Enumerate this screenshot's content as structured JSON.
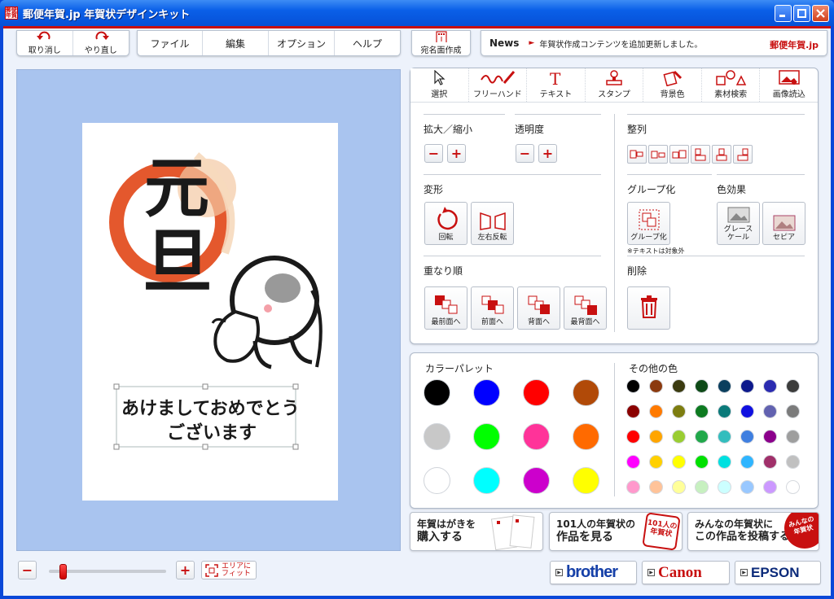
{
  "window": {
    "title": "郵便年賀.jp 年賀状デザインキット",
    "icon_text": "郵便年賀"
  },
  "toolbar": {
    "undo": "取り消し",
    "redo": "やり直し",
    "menu": [
      "ファイル",
      "編集",
      "オプション",
      "ヘルプ"
    ],
    "address_side": "宛名面作成"
  },
  "news": {
    "label": "News",
    "text": "年賀状作成コンテンツを追加更新しました。",
    "logo": "郵便年賀.jp"
  },
  "card": {
    "kanji_top": "元",
    "kanji_bottom": "旦",
    "greeting_line1": "あけましておめでとう",
    "greeting_line2": "ございます"
  },
  "tabs": [
    "選択",
    "フリーハンド",
    "テキスト",
    "スタンプ",
    "背景色",
    "素材検索",
    "画像読込"
  ],
  "tools": {
    "zoom_label": "拡大／縮小",
    "opacity_label": "透明度",
    "align_label": "整列",
    "transform_label": "変形",
    "rotate": "回転",
    "flip": "左右反転",
    "group_label": "グループ化",
    "group_button": "グループ化",
    "group_note": "※テキストは対象外",
    "color_effect_label": "色効果",
    "gray": "グレースケール",
    "sepia": "セピア",
    "order_label": "重なり順",
    "front_most": "最前面へ",
    "front": "前面へ",
    "back": "背面へ",
    "back_most": "最背面へ",
    "delete_label": "削除",
    "minus": "−",
    "plus": "+"
  },
  "palette": {
    "label": "カラーパレット",
    "other_label": "その他の色",
    "main_colors": [
      "#000000",
      "#0000ff",
      "#ff0000",
      "#b14a08",
      "#c8c8c8",
      "#00ff00",
      "#ff3399",
      "#ff6a00",
      "#ffffff",
      "#00ffff",
      "#cc00cc",
      "#ffff00"
    ],
    "other_colors": [
      "#000000",
      "#8b3a0f",
      "#3b3b10",
      "#0e4a17",
      "#0b3f5e",
      "#0d1a8c",
      "#2b2bb0",
      "#3c3c3c",
      "#8a0000",
      "#ff7a00",
      "#7d7d10",
      "#0d7a20",
      "#0b7a7a",
      "#1010e0",
      "#6262b0",
      "#7b7b7b",
      "#ff0000",
      "#ffa500",
      "#9acd32",
      "#21a84a",
      "#33bdbd",
      "#3f7fe0",
      "#8b008b",
      "#9e9e9e",
      "#ff00ff",
      "#ffd000",
      "#ffff00",
      "#00e000",
      "#00e0e0",
      "#2fb5ff",
      "#a0306a",
      "#c0c0c0",
      "#ff99cc",
      "#ffc399",
      "#ffff99",
      "#c7f0c0",
      "#ccffff",
      "#99c8ff",
      "#cc99ff",
      "#ffffff"
    ]
  },
  "banners": {
    "buy_line1": "年賀はがきを",
    "buy_line2": "購入する",
    "works_line1": "101人の年賀状の",
    "works_line2": "作品を見る",
    "works_badge": "101人の年賀状",
    "post_line1": "みんなの年賀状に",
    "post_line2": "この作品を投稿する",
    "post_badge": "みんなの年賀状"
  },
  "brands": [
    "brother",
    "Canon",
    "EPSON"
  ],
  "zoom": {
    "minus": "−",
    "plus": "+",
    "fit": "エリアにフィット",
    "fit_line1": "エリアに",
    "fit_line2": "フィット",
    "level": 0.12
  }
}
